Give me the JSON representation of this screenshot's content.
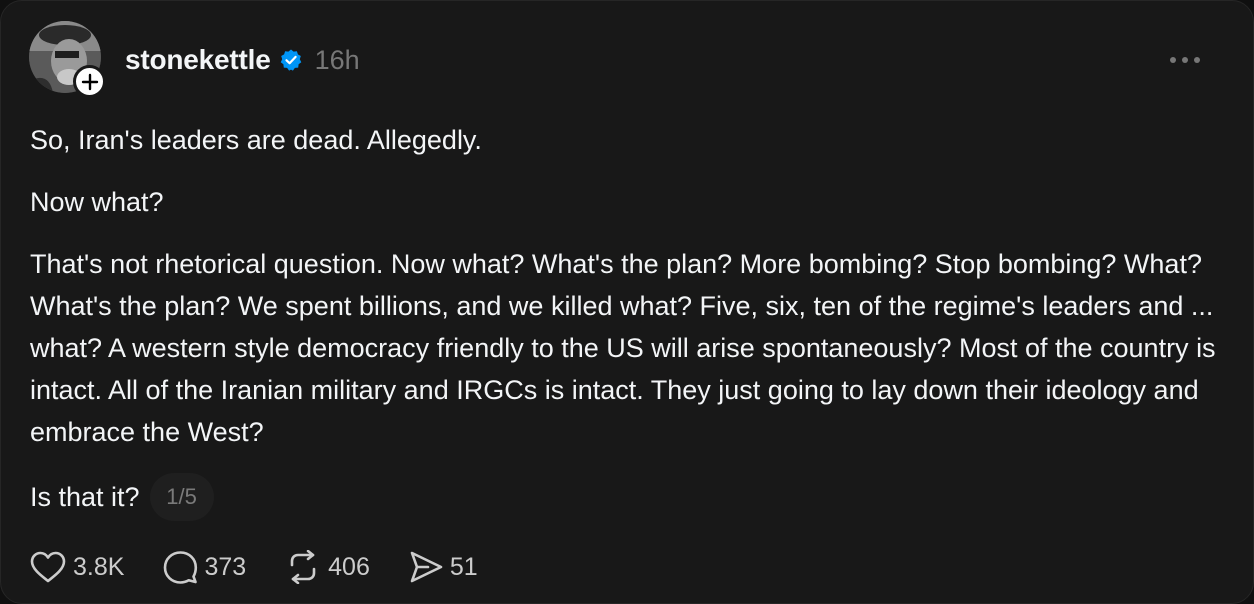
{
  "author": {
    "username": "stonekettle",
    "time_ago": "16h",
    "verified": true,
    "verified_color": "#0095f6"
  },
  "post": {
    "paragraphs": [
      "So, Iran's leaders are dead. Allegedly.",
      "Now what?",
      "That's not rhetorical question. Now what? What's the plan? More bombing? Stop bombing? What? What's the plan? We spent billions, and we killed what? Five, six, ten of the regime's leaders and ... what? A western style democracy friendly to the US will arise spontaneously? Most of the country is intact. All of the Iranian military and IRGCs is intact. They just going to lay down their ideology and embrace the West?"
    ],
    "last_line": "Is that it?",
    "thread_counter": "1/5"
  },
  "actions": {
    "likes": "3.8K",
    "replies": "373",
    "reposts": "406",
    "shares": "51"
  },
  "icons": {
    "follow": "plus-icon",
    "verified": "verified-check-icon",
    "more": "more-horizontal-icon",
    "like": "heart-icon",
    "reply": "comment-icon",
    "repost": "repost-icon",
    "share": "send-icon"
  }
}
